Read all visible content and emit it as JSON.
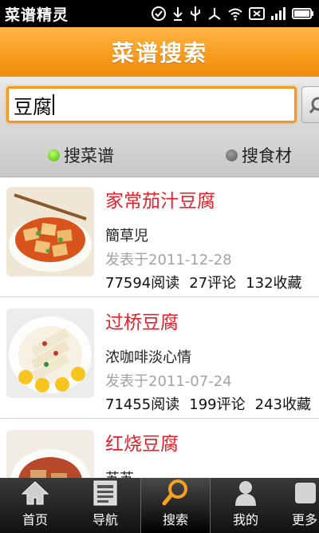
{
  "status_bar": {
    "title": "菜谱精灵"
  },
  "header": {
    "title": "菜谱搜索"
  },
  "search": {
    "value": "豆腐"
  },
  "search_type": {
    "recipe_label": "搜菜谱",
    "ingredient_label": "搜食材",
    "selected": "recipe"
  },
  "results": [
    {
      "title": "家常茄汁豆腐",
      "author": "簡草児",
      "date": "发表于2011-12-28",
      "reads": "77594阅读",
      "comments": "27评论",
      "favorites": "132收藏"
    },
    {
      "title": "过桥豆腐",
      "author": "浓咖啡淡心情",
      "date": "发表于2011-07-24",
      "reads": "71455阅读",
      "comments": "199评论",
      "favorites": "243收藏"
    },
    {
      "title": "红烧豆腐",
      "author": "苏苏"
    }
  ],
  "bottom_nav": [
    {
      "label": "首页",
      "icon": "home-icon"
    },
    {
      "label": "导航",
      "icon": "book-icon"
    },
    {
      "label": "搜索",
      "icon": "search-icon",
      "active": true
    },
    {
      "label": "我的",
      "icon": "user-icon"
    },
    {
      "label": "更多",
      "icon": "more-icon"
    }
  ],
  "colors": {
    "accent": "#f89d1f",
    "title_red": "#e4202a",
    "selected_dot": "#47b800"
  }
}
